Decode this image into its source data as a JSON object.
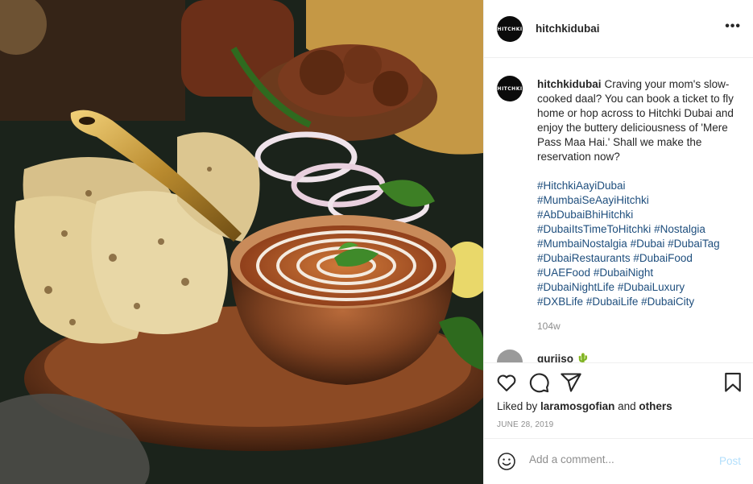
{
  "post": {
    "account": {
      "username": "hitchkidubai",
      "avatar_text": "HITCHKI"
    },
    "caption": {
      "username": "hitchkidubai",
      "text": "Craving your mom's slow-cooked daal? You can book a ticket to fly home or hop across to Hitchki Dubai and enjoy the buttery deliciousness of 'Mere Pass Maa Hai.' Shall we make the reservation now?",
      "hashtags": [
        "#HitchkiAayiDubai",
        "#MumbaiSeAayiHitchki",
        "#AbDubaiBhiHitchki",
        "#DubaiItsTimeToHitchki",
        "#Nostalgia",
        "#MumbaiNostalgia",
        "#Dubai",
        "#DubaiTag",
        "#DubaiRestaurants",
        "#DubaiFood",
        "#UAEFood",
        "#DubaiNight",
        "#DubaiNightLife",
        "#DubaiLuxury",
        "#DXBLife",
        "#DubaiLife",
        "#DubaiCity"
      ],
      "age": "104w"
    },
    "reply": {
      "username": "guriiso 🌵"
    },
    "likes": {
      "prefix": "Liked by ",
      "user": "laramosgofian",
      "suffix": " and ",
      "others": "others"
    },
    "date": "JUNE 28, 2019",
    "comment": {
      "placeholder": "Add a comment...",
      "post_label": "Post"
    },
    "icons": [
      "heart-icon",
      "comment-icon",
      "share-icon",
      "bookmark-icon",
      "more-icon",
      "emoji-icon"
    ],
    "colors": {
      "text": "#262626",
      "secondary": "#8e8e8e",
      "hashtag": "#1e4e7d",
      "post_disabled": "#b2dffc",
      "border": "#efefef"
    }
  }
}
